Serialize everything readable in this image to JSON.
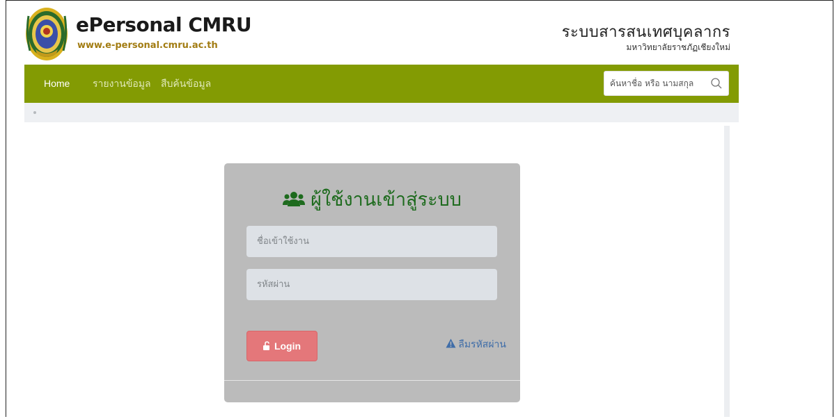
{
  "header": {
    "brand_name": "ePersonal CMRU",
    "brand_url": "www.e-personal.cmru.ac.th",
    "system_title": "ระบบสารสนเทศบุคลากร",
    "university_name": "มหาวิทยาลัยราชภัฏเชียงใหม่"
  },
  "navbar": {
    "items": [
      {
        "label": "Home",
        "active": true
      },
      {
        "label": "รายงานข้อมูล",
        "active": false
      },
      {
        "label": "สืบค้นข้อมูล",
        "active": false
      }
    ],
    "search": {
      "placeholder": "ค้นหาชื่อ หรือ นามสกุล",
      "icon": "search-icon"
    },
    "color": "#839b03"
  },
  "login": {
    "heading": "ผู้ใช้งานเข้าสู่ระบบ",
    "heading_icon": "users-icon",
    "username_placeholder": "ชื่อเข้าใช้งาน",
    "password_placeholder": "รหัสผ่าน",
    "login_label": "Login",
    "login_icon": "unlock-icon",
    "forgot_label": "ลืมรหัสผ่าน",
    "forgot_icon": "warning-icon",
    "colors": {
      "heading": "#1e6b1e",
      "button": "#e4777a",
      "link": "#3f6da8",
      "card": "#bbbbbb"
    }
  }
}
